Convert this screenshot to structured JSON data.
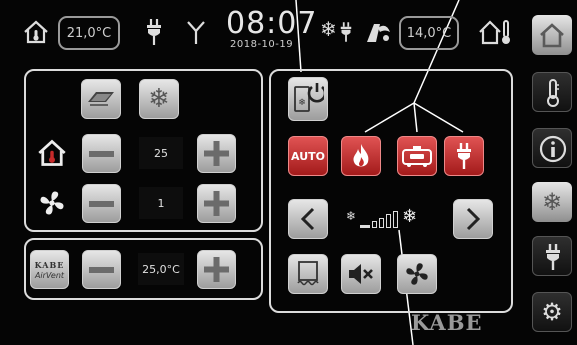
{
  "status_bar": {
    "indoor_temp": "21,0°C",
    "time": "08:07",
    "date": "2018-10-19",
    "outdoor_temp": "14,0°C"
  },
  "climate_panel": {
    "temperature_value": "25",
    "fan_value": "1"
  },
  "airvent_panel": {
    "airvent_logo_text": "KABE",
    "airvent_label": "AirVent",
    "temperature_value": "25,0°C"
  },
  "mode_panel": {
    "auto_label": "AUTO"
  },
  "watermark": "KABE",
  "icons": {
    "house": "house-thermometer-icon",
    "plug": "plug-icon",
    "antenna": "antenna-icon",
    "snow": "snowflake-icon",
    "gas": "gas-bottle-icon",
    "fan": "fan-icon",
    "mute": "mute-icon"
  },
  "colors": {
    "background": "#050505",
    "active_red": "#c62a2a",
    "button_grey": "#c8c8c8",
    "panel_border": "#dcdcdc"
  }
}
